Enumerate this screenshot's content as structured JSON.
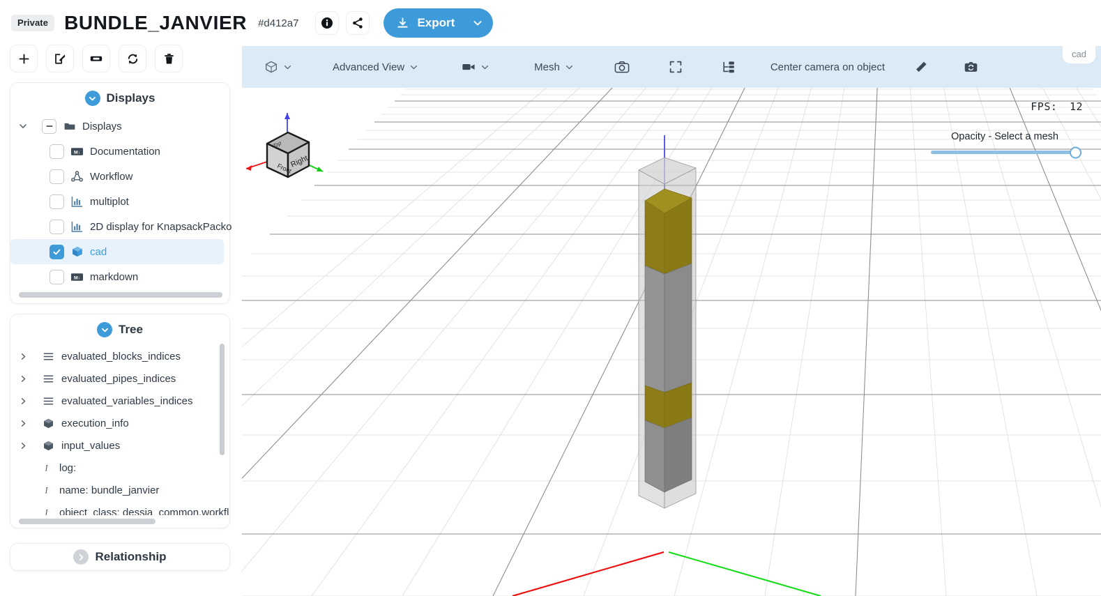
{
  "header": {
    "visibility_badge": "Private",
    "title": "BUNDLE_JANVIER",
    "hash": "#d412a7",
    "info_icon": "info-icon",
    "share_icon": "share-icon",
    "export_label": "Export",
    "export_caret_icon": "chevron-down-icon",
    "accent_color": "#3d9bd9"
  },
  "left_toolbar": {
    "buttons": [
      {
        "name": "add-button",
        "icon": "plus-icon"
      },
      {
        "name": "edit-button",
        "icon": "pencil-square-icon"
      },
      {
        "name": "rename-button",
        "icon": "tag-icon"
      },
      {
        "name": "refresh-button",
        "icon": "refresh-icon"
      },
      {
        "name": "delete-button",
        "icon": "trash-icon"
      }
    ]
  },
  "displays_panel": {
    "title": "Displays",
    "toggle_icon": "chevron-down-circle-icon",
    "root": {
      "label": "Displays",
      "icon": "folder-icon",
      "checkbox_state": "indeterminate",
      "expanded": true
    },
    "items": [
      {
        "label": "Documentation",
        "icon": "markdown-icon",
        "checked": false,
        "selected": false
      },
      {
        "label": "Workflow",
        "icon": "workflow-icon",
        "checked": false,
        "selected": false
      },
      {
        "label": "multiplot",
        "icon": "bar-chart-icon",
        "checked": false,
        "selected": false
      },
      {
        "label": "2D display for KnapsackPacko",
        "icon": "bar-chart-icon",
        "checked": false,
        "selected": false
      },
      {
        "label": "cad",
        "icon": "cube-icon",
        "checked": true,
        "selected": true
      },
      {
        "label": "markdown",
        "icon": "markdown-icon",
        "checked": false,
        "selected": false
      }
    ]
  },
  "tree_panel": {
    "title": "Tree",
    "toggle_icon": "chevron-down-circle-icon",
    "items": [
      {
        "label": "evaluated_blocks_indices",
        "icon": "list-icon",
        "expandable": true
      },
      {
        "label": "evaluated_pipes_indices",
        "icon": "list-icon",
        "expandable": true
      },
      {
        "label": "evaluated_variables_indices",
        "icon": "list-icon",
        "expandable": true
      },
      {
        "label": "execution_info",
        "icon": "cube-icon",
        "expandable": true
      },
      {
        "label": "input_values",
        "icon": "cube-icon",
        "expandable": true
      },
      {
        "label": "log:",
        "icon": "text-icon",
        "expandable": false
      },
      {
        "label": "name: bundle_janvier",
        "icon": "text-icon",
        "expandable": false
      },
      {
        "label": "object_class: dessia_common.workfl",
        "icon": "text-icon",
        "expandable": false
      }
    ]
  },
  "relationship_panel": {
    "title": "Relationship",
    "toggle_icon": "chevron-right-circle-icon",
    "collapsed": true
  },
  "viewer": {
    "tab_label": "cad",
    "toolbar": [
      {
        "name": "view-cube-menu",
        "label": "",
        "icon": "cube-outline-icon",
        "caret": true
      },
      {
        "name": "advanced-view-menu",
        "label": "Advanced View",
        "icon": "",
        "caret": true
      },
      {
        "name": "camera-video-menu",
        "label": "",
        "icon": "video-camera-icon",
        "caret": true
      },
      {
        "name": "mesh-menu",
        "label": "Mesh",
        "icon": "",
        "caret": true
      },
      {
        "name": "screenshot-button",
        "label": "",
        "icon": "photo-camera-icon",
        "caret": false
      },
      {
        "name": "fullscreen-button",
        "label": "",
        "icon": "expand-icon",
        "caret": false
      },
      {
        "name": "tree-structure-button",
        "label": "",
        "icon": "tree-structure-icon",
        "caret": false
      },
      {
        "name": "center-camera-button",
        "label": "Center camera on object",
        "icon": "",
        "caret": false
      },
      {
        "name": "measure-button",
        "label": "",
        "icon": "ruler-icon",
        "caret": false
      },
      {
        "name": "reset-camera-button",
        "label": "",
        "icon": "camera-reset-icon",
        "caret": false
      }
    ],
    "fps_label": "FPS:",
    "fps_value": "12",
    "opacity_label": "Opacity - Select a mesh",
    "opacity_value": 100,
    "nav_cube": {
      "front_face": "Front",
      "right_face": "Right",
      "top_face": "Top"
    },
    "axes": {
      "x_color": "#ee1111",
      "y_color": "#11dd11",
      "z_color": "#5b5bef"
    },
    "model": {
      "description": "tall rectangular column with gray and olive-yellow segments inside a translucent shell",
      "shell_color": "#cfcfcf",
      "gray_color": "#8a8a8a",
      "yellow_color": "#8d7d18"
    }
  }
}
